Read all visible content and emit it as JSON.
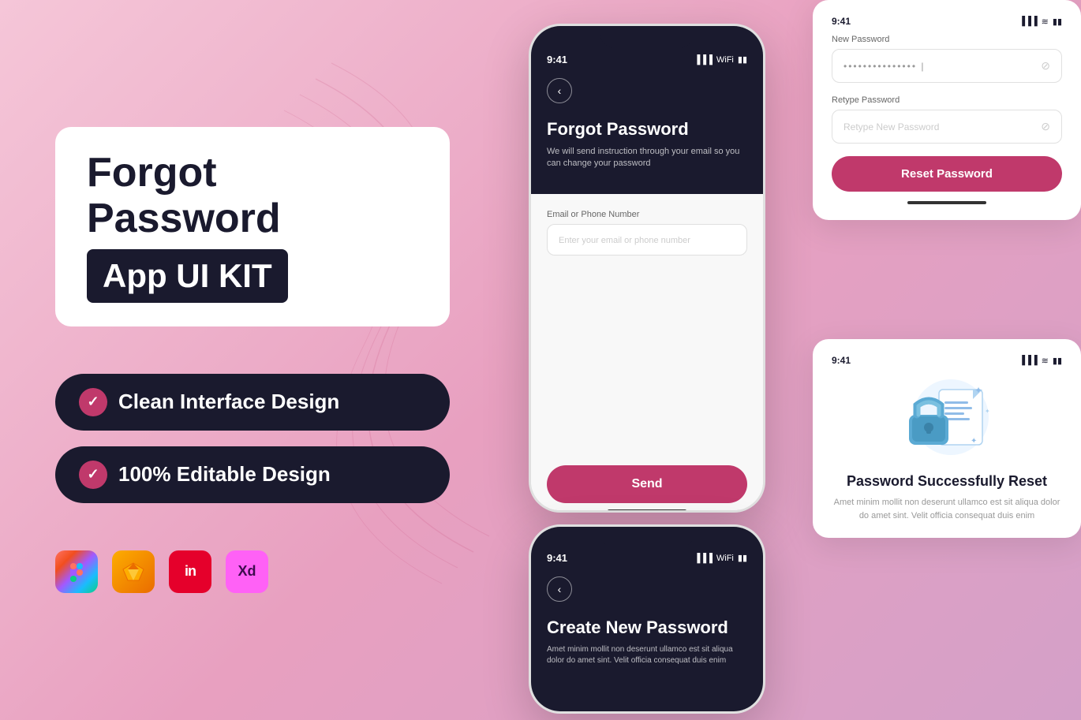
{
  "background": {
    "gradient_start": "#f5c6d8",
    "gradient_end": "#d4a0c8"
  },
  "left_panel": {
    "title_line1": "Forgot Password",
    "title_line2": "App UI KIT",
    "feature1": "Clean Interface Design",
    "feature2": "100% Editable Design",
    "tools": [
      "Figma",
      "Sketch",
      "InVision",
      "Adobe XD"
    ]
  },
  "phone_main": {
    "time": "9:41",
    "screen_title": "Forgot Password",
    "screen_subtitle": "We will send instruction through your email so you can change your password",
    "input_label": "Email or Phone Number",
    "input_placeholder": "Enter your email or phone number",
    "send_button": "Send"
  },
  "phone_bottom": {
    "time": "9:41",
    "screen_title": "Create New Password",
    "screen_subtitle": "Amet minim mollit non deserunt ullamco est sit aliqua dolor do amet sint. Velit officia consequat duis enim"
  },
  "card_reset": {
    "new_password_label": "New Password",
    "new_password_placeholder": "••••••••••••••• |",
    "retype_label": "Retype Password",
    "retype_placeholder": "Retype New Password",
    "reset_button": "Reset Password",
    "time": "9:41"
  },
  "card_success": {
    "time": "9:41",
    "title": "Password Successfully Reset",
    "description": "Amet minim mollit non deserunt ullamco est sit aliqua dolor do amet sint. Velit officia consequat duis enim"
  }
}
